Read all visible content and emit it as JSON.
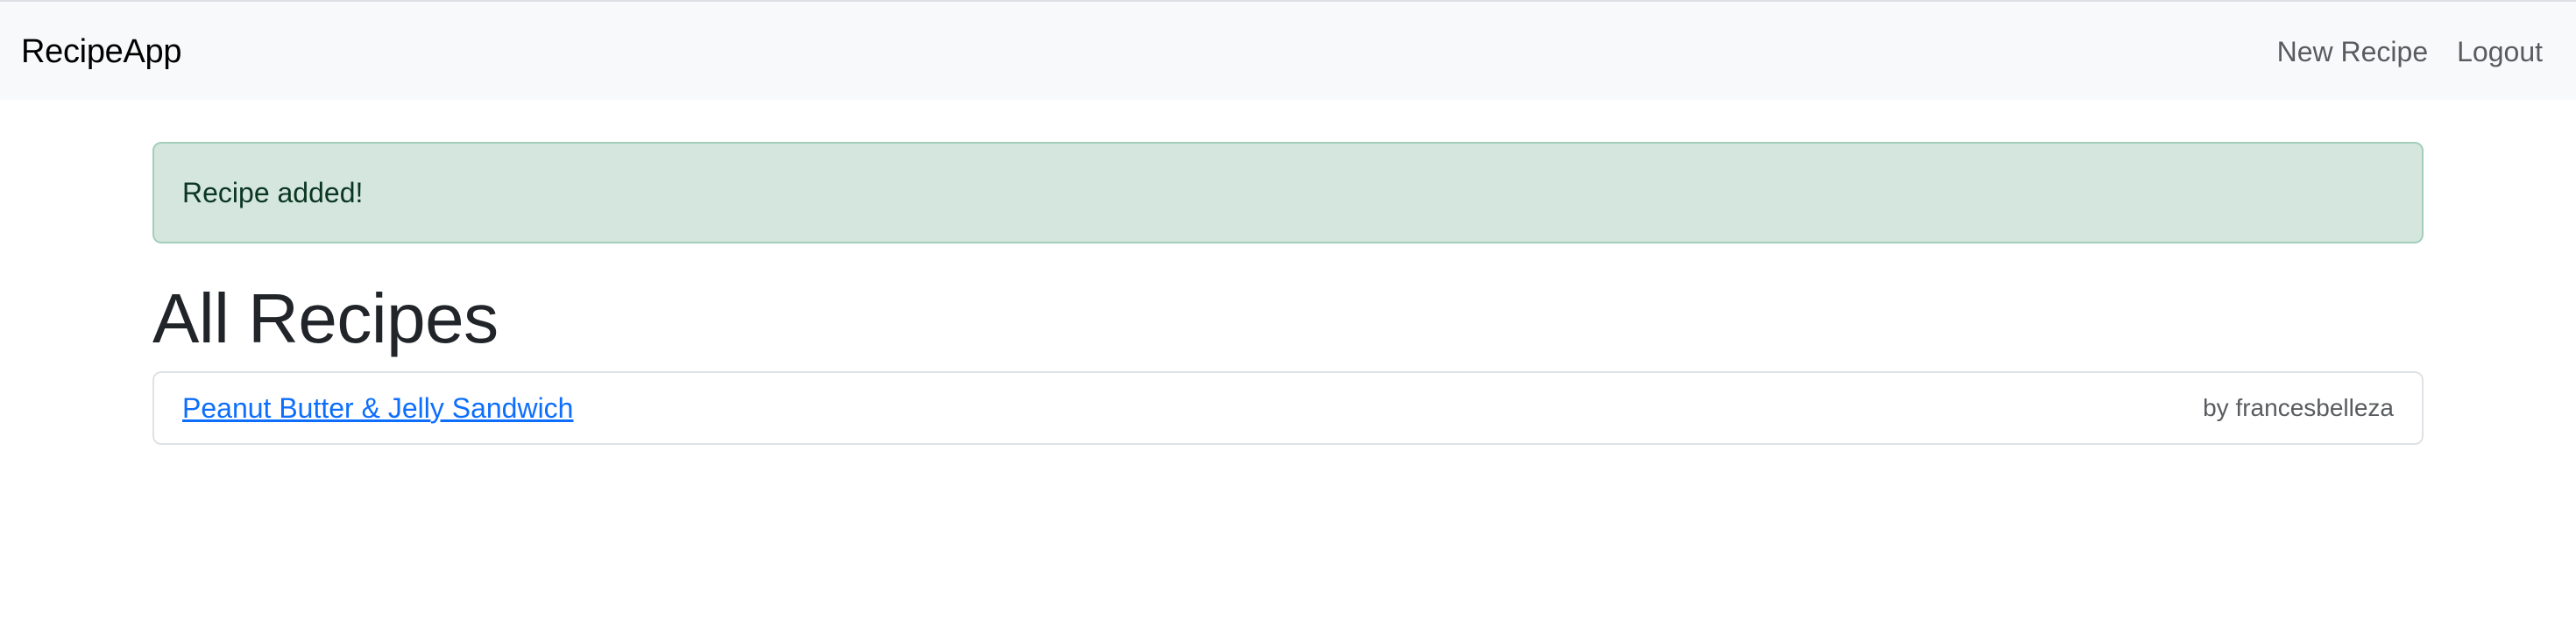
{
  "navbar": {
    "brand": "RecipeApp",
    "links": [
      {
        "label": "New Recipe"
      },
      {
        "label": "Logout"
      }
    ]
  },
  "alert": {
    "message": "Recipe added!",
    "status_color": "#d4e6de"
  },
  "main": {
    "title": "All Recipes",
    "recipes": [
      {
        "title": "Peanut Butter & Jelly Sandwich",
        "author": "by francesbelleza"
      }
    ]
  },
  "colors": {
    "link": "#0d6efd",
    "navbar_bg": "#f8f9fa",
    "alert_border": "#a3cfbb"
  }
}
